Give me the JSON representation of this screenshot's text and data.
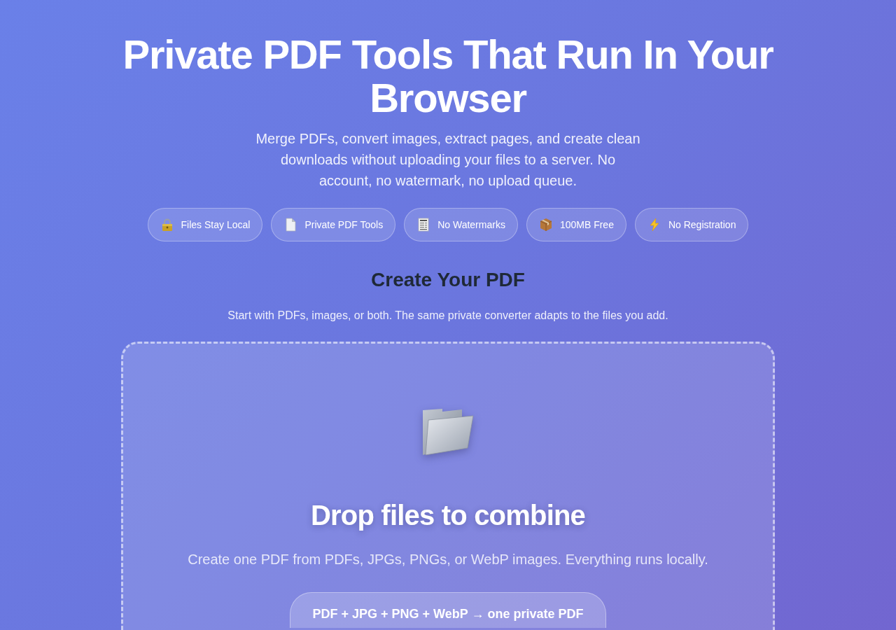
{
  "hero": {
    "title": "Private PDF Tools That Run In Your Browser",
    "subtitle": "Merge PDFs, convert images, extract pages, and create clean downloads without uploading your files to a server. No account, no watermark, no upload queue."
  },
  "badges": [
    "Files Stay Local",
    "Private PDF Tools",
    "No Watermarks",
    "100MB Free",
    "No Registration"
  ],
  "converter": {
    "title": "Create Your PDF",
    "subtitle": "Start with PDFs, images, or both. The same private converter adapts to the files you add."
  },
  "drop_zone": {
    "title": "Drop files to combine",
    "description": "Create one PDF from PDFs, JPGs, PNGs, or WebP images. Everything runs locally.",
    "button": "PDF + JPG + PNG + WebP → one private PDF"
  }
}
